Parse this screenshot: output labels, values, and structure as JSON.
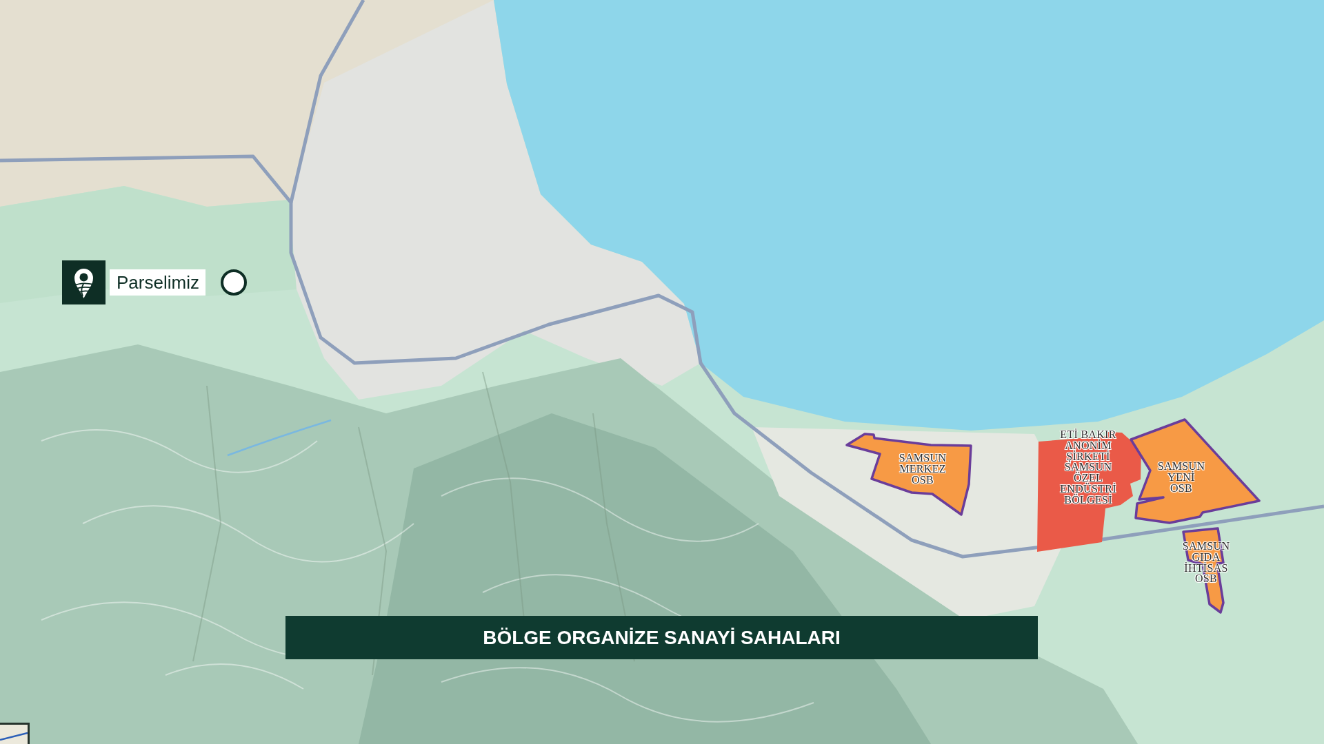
{
  "marker": {
    "label": "Parselimiz"
  },
  "zones": [
    {
      "label": "SAMSUN MERKEZ OSB",
      "color": "#f79a45",
      "outlined": true
    },
    {
      "label": "ETİ BAKIR ANONİM ŞİRKETİ SAMSUN ÖZEL ENDÜSTRİ BÖLGESİ",
      "color": "#ea5a48",
      "outlined": false
    },
    {
      "label": "SAMSUN YENİ OSB",
      "color": "#f79a45",
      "outlined": true
    },
    {
      "label": "SAMSUN GIDA İHTİSAS OSB",
      "color": "#f79a45",
      "outlined": true
    }
  ],
  "banner": {
    "title": "BÖLGE ORGANİZE SANAYİ SAHALARI"
  }
}
